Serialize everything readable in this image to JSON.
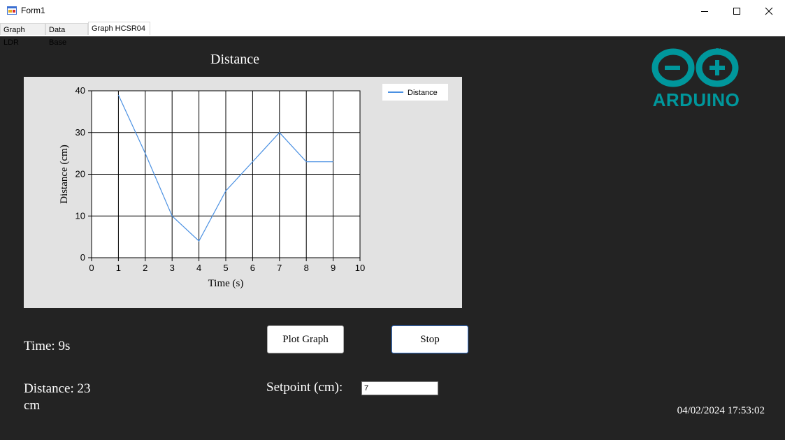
{
  "window": {
    "title": "Form1"
  },
  "tabs": [
    {
      "label": "Graph LDR",
      "active": false
    },
    {
      "label": "Data Base",
      "active": false
    },
    {
      "label": "Graph HCSR04",
      "active": true
    }
  ],
  "chart_title": "Distance",
  "chart_data": {
    "type": "line",
    "title": "Distance",
    "xlabel": "Time (s)",
    "ylabel": "Distance (cm)",
    "xlim": [
      0,
      10
    ],
    "ylim": [
      0,
      40
    ],
    "xticks": [
      0,
      1,
      2,
      3,
      4,
      5,
      6,
      7,
      8,
      9,
      10
    ],
    "yticks": [
      0,
      10,
      20,
      30,
      40
    ],
    "grid": true,
    "legend": "top-right",
    "series": [
      {
        "name": "Distance",
        "color": "#4a90e2",
        "x": [
          1,
          2,
          3,
          4,
          5,
          6,
          7,
          8,
          9
        ],
        "y": [
          39,
          25,
          10,
          4,
          16,
          23,
          30,
          23,
          23
        ]
      }
    ]
  },
  "labels": {
    "time": "Time: 9s",
    "distance_line1": "Distance: 23",
    "distance_line2": "cm",
    "setpoint": "Setpoint (cm):"
  },
  "buttons": {
    "plot": "Plot Graph",
    "stop": "Stop"
  },
  "setpoint_input": {
    "value": "7"
  },
  "datetime": "04/02/2024 17:53:02",
  "logo": {
    "text": "ARDUINO",
    "color": "#00979c"
  }
}
